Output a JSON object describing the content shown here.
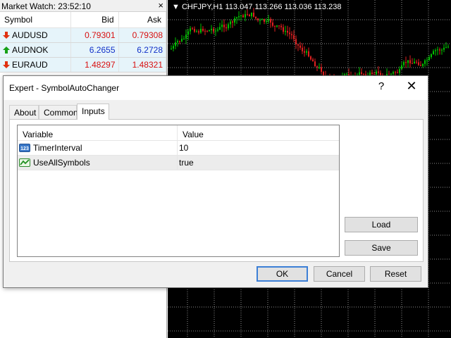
{
  "market_watch": {
    "title": "Market Watch: 23:52:10",
    "close_glyph": "×",
    "headers": {
      "symbol": "Symbol",
      "bid": "Bid",
      "ask": "Ask"
    },
    "rows": [
      {
        "symbol": "AUDUSD",
        "bid": "0.79301",
        "ask": "0.79308",
        "direction": "down",
        "bid_color": "#d81010",
        "ask_color": "#d81010"
      },
      {
        "symbol": "AUDNOK",
        "bid": "6.2655",
        "ask": "6.2728",
        "direction": "up",
        "bid_color": "#1030c8",
        "ask_color": "#1030c8"
      },
      {
        "symbol": "EURAUD",
        "bid": "1.48297",
        "ask": "1.48321",
        "direction": "down",
        "bid_color": "#d81010",
        "ask_color": "#d81010"
      }
    ]
  },
  "chart": {
    "title": "CHFJPY,H1  113.047 113.266 113.036 113.238",
    "bull_color": "#00c000",
    "bear_color": "#e02020"
  },
  "dialog": {
    "title": "Expert - SymbolAutoChanger",
    "help_glyph": "?",
    "close_glyph": "✕",
    "tabs": [
      {
        "label": "About",
        "active": false
      },
      {
        "label": "Common",
        "active": false
      },
      {
        "label": "Inputs",
        "active": true
      }
    ],
    "grid": {
      "headers": {
        "variable": "Variable",
        "value": "Value"
      },
      "rows": [
        {
          "variable": "TimerInterval",
          "value": "10",
          "icon": "integer-icon",
          "icon_text": "123"
        },
        {
          "variable": "UseAllSymbols",
          "value": "true",
          "icon": "boolean-icon",
          "icon_text": ""
        }
      ]
    },
    "buttons": {
      "load": "Load",
      "save": "Save",
      "ok": "OK",
      "cancel": "Cancel",
      "reset": "Reset"
    }
  }
}
